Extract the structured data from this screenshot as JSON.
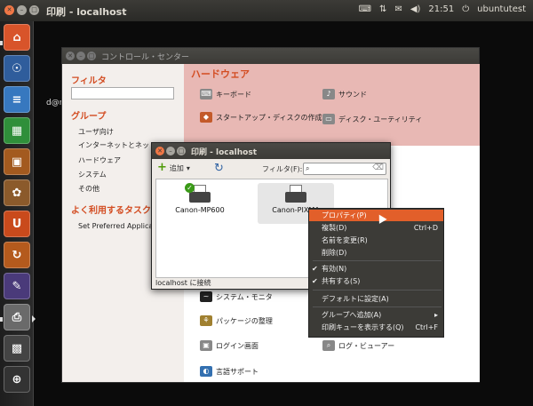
{
  "top_panel": {
    "title": "印刷 - localhost",
    "clock": "21:51",
    "user": "ubuntutest",
    "icons": [
      "keyboard-icon",
      "network-icon",
      "envelope-icon",
      "volume-icon",
      "power-icon"
    ]
  },
  "launcher": {
    "items": [
      "home-folder-icon",
      "firefox-icon",
      "writer-icon",
      "calc-icon",
      "impress-icon",
      "software-center-icon",
      "ubuntu-one-icon",
      "updates-icon",
      "settings-icon",
      "printer-icon",
      "workspace-switcher-icon",
      "trash-icon"
    ],
    "home_glyph": "⌂",
    "firefox_glyph": "☉",
    "writer_glyph": "≡",
    "calc_glyph": "▦",
    "impress_glyph": "▣",
    "software_glyph": "✿",
    "ubuntu_one_glyph": "U",
    "updates_glyph": "↻",
    "settings_glyph": "✎",
    "printer_glyph": "⎙",
    "workspace_glyph": "▩",
    "trash_glyph": "⊕"
  },
  "desktop": {
    "partial_text": "d@r"
  },
  "control_center": {
    "title": "コントロール・センター",
    "sidebar": {
      "filter_heading": "フィルタ",
      "group_heading": "グループ",
      "groups": [
        "ユーザ向け",
        "インターネットとネットワ",
        "ハードウェア",
        "システム",
        "その他"
      ],
      "frequent_heading": "よく利用するタスク",
      "frequent_items": [
        "Set Preferred Applica"
      ]
    },
    "main": {
      "section_title": "ハードウェア",
      "items": [
        "キーボード",
        "サウンド",
        "スタートアップ・ディスクの作成",
        "ディスク・ユーティリティ"
      ],
      "other_items": [
        "システム・モニタ",
        "パッケージの整理",
        "ログイン画面",
        "ログ・ビューアー",
        "言語サポート"
      ]
    }
  },
  "print_dialog": {
    "title": "印刷 - localhost",
    "add_label": "追加",
    "add_dropdown": "▾",
    "filter_label": "フィルタ(F):",
    "search_value": "",
    "printers": [
      {
        "name": "Canon-MP600",
        "default": true
      },
      {
        "name": "Canon-PIXMA",
        "default": false
      }
    ],
    "status": "localhost に接続"
  },
  "context_menu": {
    "items": [
      {
        "label": "プロパティ(P)",
        "shortcut": "",
        "highlighted": true
      },
      {
        "label": "複製(D)",
        "shortcut": "Ctrl+D"
      },
      {
        "label": "名前を変更(R)",
        "shortcut": ""
      },
      {
        "label": "削除(D)",
        "shortcut": ""
      },
      {
        "label": "有効(N)",
        "shortcut": "",
        "checked": true
      },
      {
        "label": "共有する(S)",
        "shortcut": "",
        "checked": true
      },
      {
        "label": "デフォルトに設定(A)",
        "shortcut": ""
      },
      {
        "label": "グループへ追加(A)",
        "shortcut": "",
        "submenu": true
      },
      {
        "label": "印刷キューを表示する(Q)",
        "shortcut": "Ctrl+F"
      }
    ],
    "check_glyph": "✔",
    "submenu_glyph": "▸"
  },
  "colors": {
    "accent": "#e25f2a",
    "panel": "#3c3b37",
    "heading": "#d34c21",
    "pink": "#e8b8b4"
  }
}
